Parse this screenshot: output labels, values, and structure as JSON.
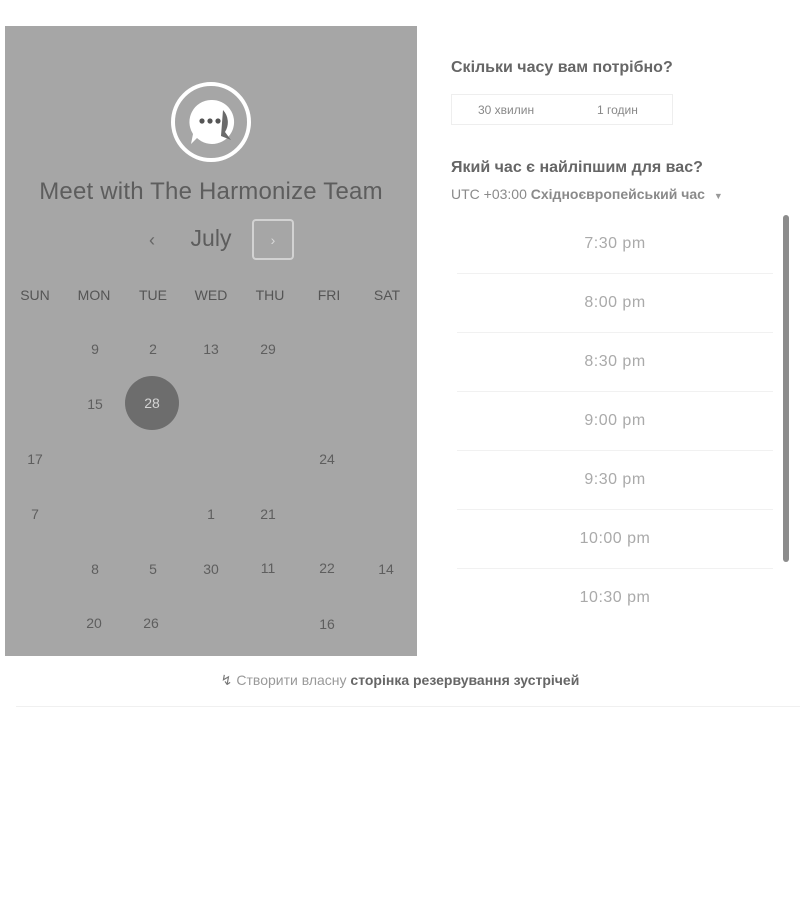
{
  "calendar": {
    "title": "Meet with The Harmonize Team",
    "month": "July",
    "prev_icon": "chevron-left",
    "next_icon": "chevron-right",
    "weekdays": [
      "SUN",
      "MON",
      "TUE",
      "WED",
      "THU",
      "FRI",
      "SAT"
    ],
    "days": [
      {
        "label": "9"
      },
      {
        "label": "2"
      },
      {
        "label": "13"
      },
      {
        "label": "29"
      },
      {
        "label": "15"
      },
      {
        "label": "28",
        "selected": true
      },
      {
        "label": "17"
      },
      {
        "label": "24"
      },
      {
        "label": "7"
      },
      {
        "label": "1"
      },
      {
        "label": "21"
      },
      {
        "label": "8"
      },
      {
        "label": "5"
      },
      {
        "label": "30"
      },
      {
        "label": "11"
      },
      {
        "label": "22"
      },
      {
        "label": "14"
      },
      {
        "label": "20"
      },
      {
        "label": "26"
      },
      {
        "label": "16"
      }
    ],
    "colors": {
      "panel": "#a6a6a6",
      "selected": "#6d6d6d"
    }
  },
  "booking": {
    "duration_question": "Скільки часу вам потрібно?",
    "durations": [
      "30 хвилин",
      "1 годин"
    ],
    "time_question": "Який час є найліпшим для вас?",
    "timezone_prefix": "UTC +03:00",
    "timezone_name": "Східноєвропейський час",
    "timezone_caret_icon": "caret-down",
    "slots": [
      "7:30 pm",
      "8:00 pm",
      "8:30 pm",
      "9:00 pm",
      "9:30 pm",
      "10:00 pm",
      "10:30 pm"
    ]
  },
  "footer": {
    "icon": "hubspot-sprocket",
    "text": "Створити власну",
    "link": "сторінка резервування зустрічей"
  }
}
